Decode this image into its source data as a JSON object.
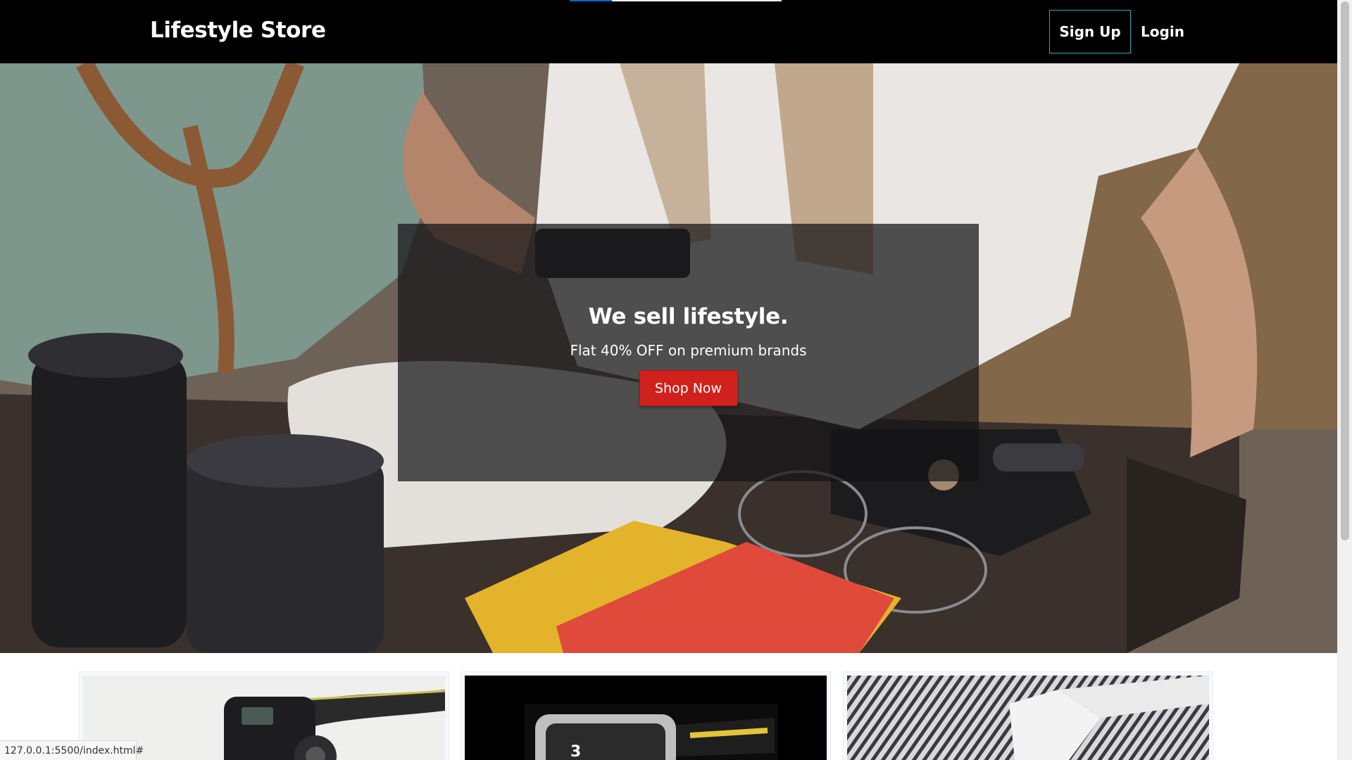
{
  "navbar": {
    "brand": "Lifestyle Store",
    "signup_label": "Sign Up",
    "login_label": "Login"
  },
  "hero": {
    "title": "We sell lifestyle.",
    "subtitle": "Flat 40% OFF on premium brands",
    "cta_label": "Shop Now"
  },
  "status_bar": {
    "url": "127.0.0.1:5500/index.html#"
  },
  "colors": {
    "navbar_bg": "#000000",
    "signup_border": "#1fb5b5",
    "cta_bg": "#d0211d",
    "overlay_bg": "rgba(20,20,22,0.72)"
  }
}
